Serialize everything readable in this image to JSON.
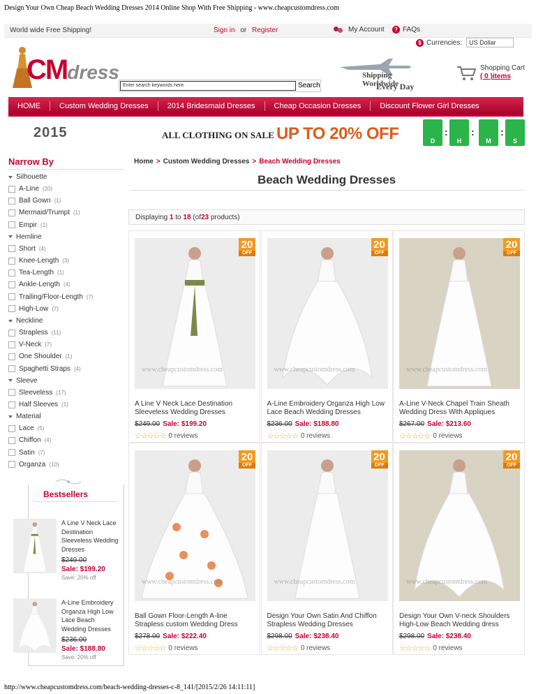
{
  "print_header": "Design Your Own Cheap Beach Wedding Dresses 2014 Online Shop With Free Shipping - www.cheapcustomdress.com",
  "print_footer": "http://www.cheapcustomdress.com/beach-wedding-dresses-c-8_141/[2015/2/26 14:11:11]",
  "topbar": {
    "shipping": "World wide Free Shipping!",
    "sign_in": "Sign in",
    "or": "or",
    "register": "Register",
    "my_account": "My Account",
    "faqs": "FAQs",
    "currencies_label": "Currencies:",
    "currency_value": "US Dollar"
  },
  "logo": {
    "cm": "CM",
    "dress": "dress"
  },
  "search": {
    "placeholder": "Enter search keywords here",
    "button": "Search"
  },
  "shipping_banner": {
    "line1": "Shipping Worldwide",
    "line2": "Every Day"
  },
  "cart": {
    "label": "Shopping Cart",
    "items": "( 0 )items"
  },
  "nav": [
    "HOME",
    "Custom Wedding Dresses",
    "2014 Bridesmaid Dresses",
    "Cheap Occasion Dresses",
    "Discount Flower Girl Dresses"
  ],
  "promo": {
    "year": "2015",
    "text": "ALL CLOTHING ON SALE",
    "upto": "UP TO",
    "pct": "20%",
    "off": "OFF",
    "countdown": [
      "D",
      "H",
      "M",
      "S"
    ]
  },
  "sidebar": {
    "title": "Narrow By",
    "groups": [
      {
        "name": "Silhouette",
        "options": [
          {
            "label": "A-Line",
            "count": "(20)"
          },
          {
            "label": "Ball Gown",
            "count": "(1)"
          },
          {
            "label": "Mermaid/Trumpt",
            "count": "(1)"
          },
          {
            "label": "Empir",
            "count": "(1)"
          }
        ]
      },
      {
        "name": "Hemline",
        "options": [
          {
            "label": "Short",
            "count": "(4)"
          },
          {
            "label": "Knee-Length",
            "count": "(3)"
          },
          {
            "label": "Tea-Length",
            "count": "(1)"
          },
          {
            "label": "Ankle-Length",
            "count": "(4)"
          },
          {
            "label": "Trailing/Floor-Length",
            "count": "(7)"
          },
          {
            "label": "High-Low",
            "count": "(7)"
          }
        ]
      },
      {
        "name": "Neckline",
        "options": [
          {
            "label": "Strapless",
            "count": "(11)"
          },
          {
            "label": "V-Neck",
            "count": "(7)"
          },
          {
            "label": "One Shoulder",
            "count": "(1)"
          },
          {
            "label": "Spaghetti Straps",
            "count": "(4)"
          }
        ]
      },
      {
        "name": "Sleeve",
        "options": [
          {
            "label": "Sleeveless",
            "count": "(17)"
          },
          {
            "label": "Half Sleeves",
            "count": "(1)"
          }
        ]
      },
      {
        "name": "Material",
        "options": [
          {
            "label": "Lace",
            "count": "(5)"
          },
          {
            "label": "Chiffon",
            "count": "(4)"
          },
          {
            "label": "Satin",
            "count": "(7)"
          },
          {
            "label": "Organza",
            "count": "(10)"
          }
        ]
      }
    ],
    "bestsellers_title": "Bestsellers",
    "bestsellers": [
      {
        "name": "A Line V Neck Lace Destination Sleeveless Wedding Dresses",
        "old": "$249.00",
        "sale": "Sale: $199.20",
        "save": "Save: 20% off"
      },
      {
        "name": "A-Line Embroidery Organza High Low Lace Beach Wedding Dresses",
        "old": "$236.00",
        "sale": "Sale: $188.80",
        "save": "Save: 20% off"
      }
    ]
  },
  "breadcrumb": {
    "home": "Home",
    "cat": "Custom Wedding Dresses",
    "current": "Beach Wedding Dresses",
    "sep": ">"
  },
  "page_title": "Beach Wedding Dresses",
  "listing": {
    "pre": "Displaying",
    "from": "1",
    "to_word": "to",
    "to": "18",
    "of_pre": "(of",
    "total": "23",
    "post": "products)"
  },
  "badge": {
    "pct": "20",
    "off": "OFF"
  },
  "watermark": "www.cheapcustomdress.com",
  "products": [
    {
      "name": "A Line V Neck Lace Destination Sleeveless Wedding Dresses",
      "old": "$249.00",
      "sale": "Sale: $199.20",
      "reviews": "0 reviews",
      "sash": "#7b8a4a"
    },
    {
      "name": "A-Line Embroidery Organza High Low Lace Beach Wedding Dresses",
      "old": "$236.00",
      "sale": "Sale: $188.80",
      "reviews": "0 reviews",
      "sash": ""
    },
    {
      "name": "A-Line V-Neck Chapel Train Sheath Wedding Dress With Appliques",
      "old": "$267.00",
      "sale": "Sale: $213.60",
      "reviews": "0 reviews",
      "sash": ""
    },
    {
      "name": "Ball Gown Floor-Length A-line Strapless custom Wedding Dress",
      "old": "$278.00",
      "sale": "Sale: $222.40",
      "reviews": "0 reviews",
      "sash": "#e6905a"
    },
    {
      "name": "Design Your Own Satin And Chiffon Strapless Wedding Dresses",
      "old": "$298.00",
      "sale": "Sale: $238.40",
      "reviews": "0 reviews",
      "sash": ""
    },
    {
      "name": "Design Your Own V-neck Shoulders High-Low Beach Wedding dress",
      "old": "$298.00",
      "sale": "Sale: $238.40",
      "reviews": "0 reviews",
      "sash": ""
    }
  ],
  "colors": {
    "accent": "#c7002f",
    "badge": "#f29a21",
    "countdown": "#2bb44a"
  }
}
